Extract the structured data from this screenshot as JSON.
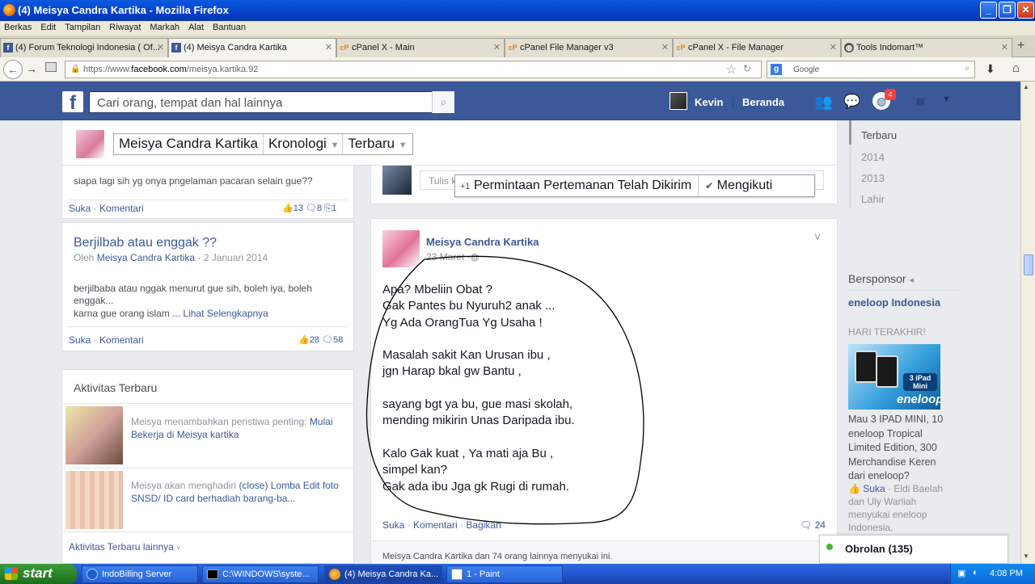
{
  "window": {
    "title": "(4) Meisya Candra Kartika - Mozilla Firefox"
  },
  "menu": [
    "Berkas",
    "Edit",
    "Tampilan",
    "Riwayat",
    "Markah",
    "Alat",
    "Bantuan"
  ],
  "tabs": [
    {
      "label": "(4) Forum Teknologi Indonesia ( Of...",
      "icon": "facebook-icon"
    },
    {
      "label": "(4) Meisya Candra Kartika",
      "icon": "facebook-icon"
    },
    {
      "label": "cPanel X - Main",
      "icon": "cpanel-icon"
    },
    {
      "label": "cPanel File Manager v3",
      "icon": "cpanel-icon"
    },
    {
      "label": "cPanel X - File Manager",
      "icon": "cpanel-icon"
    },
    {
      "label": "Tools Indomart™",
      "icon": "globe-icon"
    }
  ],
  "nav": {
    "url_prefix": "https://www.",
    "url_domain": "facebook.com",
    "url_path": "/meisya.kartika.92",
    "search_placeholder": "Google"
  },
  "fb": {
    "search_placeholder": "Cari orang, tempat dan hal lainnya",
    "user": "Kevin",
    "home": "Beranda",
    "notif_count": "4"
  },
  "timeline_bar": {
    "name": "Meisya Candra Kartika",
    "kronologi": "Kronologi",
    "terbaru": "Terbaru"
  },
  "friend_bar": {
    "request": "Permintaan Pertemanan Telah Dikirim",
    "follow": "Mengikuti"
  },
  "left": {
    "note1": {
      "text": "siapa lagi sih yg onya pngelaman pacaran selain gue??",
      "suka": "Suka",
      "komentar": "Komentari",
      "likes": "13",
      "comments": "8",
      "shares": "1"
    },
    "note2": {
      "title": "Berjilbab atau enggak ??",
      "by": "Oleh",
      "author": "Meisya Candra Kartika",
      "date": "· 2 Januari 2014",
      "body": "berjilbaba atau nggak menurut gue sih, boleh iya, boleh enggak...",
      "body2": "karna gue orang islam ...",
      "more": "Lihat Selengkapnya",
      "suka": "Suka",
      "komentar": "Komentari",
      "likes": "28",
      "comments": "58"
    },
    "activity": {
      "title": "Aktivitas Terbaru",
      "items": [
        {
          "actor": "Meisya",
          "text": "menambahkan peristiwa penting:",
          "link": "Mulai Bekerja di Meisya kartika"
        },
        {
          "actor": "Meisya",
          "text": "akan menghadiri",
          "link": "(close) Lomba Edit foto SNSD/ ID card berhadiah barang-ba..."
        }
      ],
      "more": "Aktivitas Terbaru lainnya"
    }
  },
  "composer": {
    "placeholder": "Tulis k"
  },
  "post": {
    "author": "Meisya Candra Kartika",
    "date": "23 Maret",
    "lines": [
      "Apa? Mbeliin Obat ?",
      "Gak Pantes bu Nyuruh2 anak ...",
      "Yg Ada OrangTua Yg Usaha !",
      "",
      "Masalah sakit Kan Urusan ibu ,",
      "jgn Harap bkal gw Bantu ,",
      "",
      "sayang bgt ya bu, gue masi skolah,",
      "mending mikirin Unas Daripada ibu.",
      "",
      "Kalo Gak kuat , Ya mati aja Bu ,",
      "simpel kan?",
      "Gak ada ibu Jga gk Rugi di rumah."
    ],
    "suka": "Suka",
    "komentar": "Komentari",
    "bagikan": "Bagikan",
    "comments": "24",
    "likers": "Meisya Candra Kartika dan 74 orang lainnya menyukai ini."
  },
  "years": [
    "Terbaru",
    "2014",
    "2013",
    "Lahir"
  ],
  "sponsor": {
    "heading": "Bersponsor",
    "brand": "eneloop Indonesia",
    "tag": "HARI TERAKHIR!",
    "img_text1": "3 iPad",
    "img_text2": "Mini",
    "img_logo": "eneloop",
    "body": "Mau 3 IPAD MINI, 10 eneloop Tropical Limited Edition, 300 Merchandise Keren dari eneloop?",
    "suka": "Suka",
    "likers": "· Eldi Baelah dan Uly Warliah menyukai eneloop Indonesia."
  },
  "chat": {
    "label": "Obrolan (135)"
  },
  "taskbar": {
    "start": "start",
    "items": [
      "IndoBilling Server",
      "C:\\WINDOWS\\syste...",
      "(4) Meisya Candra Ka...",
      "1 - Paint"
    ],
    "clock": "4:08 PM"
  }
}
